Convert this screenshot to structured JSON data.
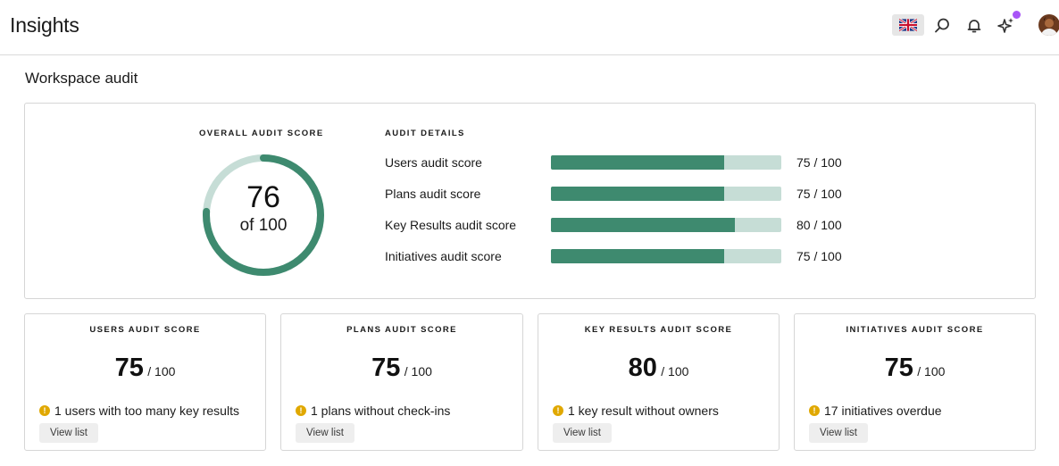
{
  "header": {
    "title": "Insights",
    "icons": [
      "uk-flag-icon",
      "search-icon",
      "bell-icon",
      "sparkle-icon",
      "avatar"
    ]
  },
  "section": {
    "title": "Workspace audit"
  },
  "overall": {
    "label": "OVERALL AUDIT SCORE",
    "value": "76",
    "sub": "of 100",
    "score": 76,
    "max": 100
  },
  "details": {
    "label": "AUDIT DETAILS",
    "rows": [
      {
        "name": "Users audit score",
        "score": 75,
        "score_text": "75 / 100"
      },
      {
        "name": "Plans audit score",
        "score": 75,
        "score_text": "75 / 100"
      },
      {
        "name": "Key Results audit score",
        "score": 80,
        "score_text": "80 / 100"
      },
      {
        "name": "Initiatives audit score",
        "score": 75,
        "score_text": "75 / 100"
      }
    ]
  },
  "cards": [
    {
      "label": "USERS AUDIT SCORE",
      "score": "75",
      "max": "/ 100",
      "warning": "1 users with too many key results",
      "button": "View list"
    },
    {
      "label": "PLANS AUDIT SCORE",
      "score": "75",
      "max": "/ 100",
      "warning": "1 plans without check-ins",
      "button": "View list"
    },
    {
      "label": "KEY RESULTS AUDIT SCORE",
      "score": "80",
      "max": "/ 100",
      "warning": "1 key result without owners",
      "button": "View list"
    },
    {
      "label": "INITIATIVES AUDIT SCORE",
      "score": "75",
      "max": "/ 100",
      "warning": "17 initiatives overdue",
      "button": "View list"
    }
  ],
  "colors": {
    "accent": "#3e8a6f",
    "track": "#c6ddd6",
    "warning": "#e0a800",
    "notification_dot": "#a855f7"
  }
}
